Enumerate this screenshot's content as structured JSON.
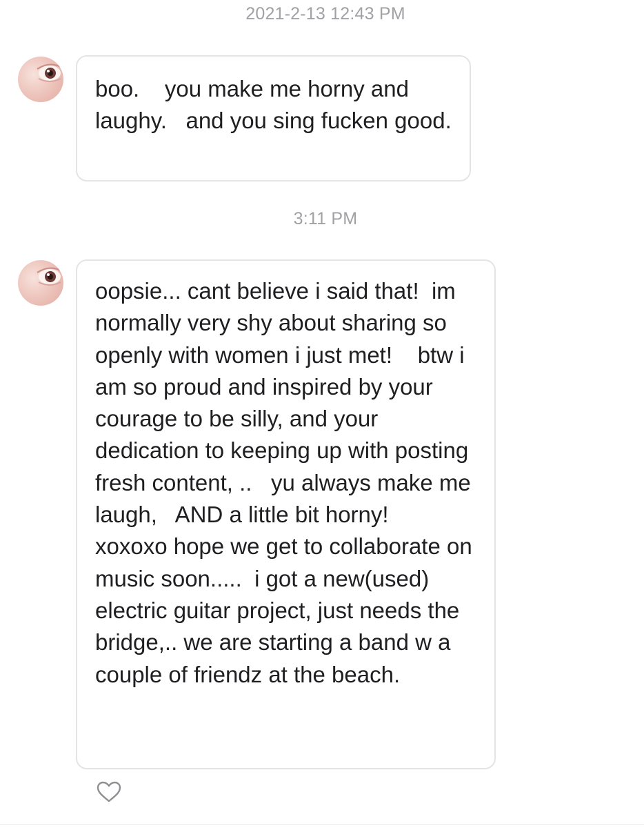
{
  "conversation": {
    "timestamps": [
      "2021-2-13 12:43 PM",
      "3:11 PM"
    ],
    "messages": [
      {
        "sender_avatar": "eye-avatar-icon",
        "text": "boo.    you make me horny and laughy.   and you sing fucken good."
      },
      {
        "sender_avatar": "eye-avatar-icon",
        "text": "oopsie... cant believe i said that!  im normally very shy about sharing so openly with women i just met!    btw i am so proud and inspired by your courage to be silly, and your dedication to keeping up with posting fresh content, ..   yu always make me laugh,   AND a little bit horny!   xoxoxo hope we get to collaborate on music soon.....  i got a new(used) electric guitar project, just needs the bridge,.. we are starting a band w a couple of friendz at the beach."
      }
    ],
    "like_icon": "heart-outline-icon"
  }
}
